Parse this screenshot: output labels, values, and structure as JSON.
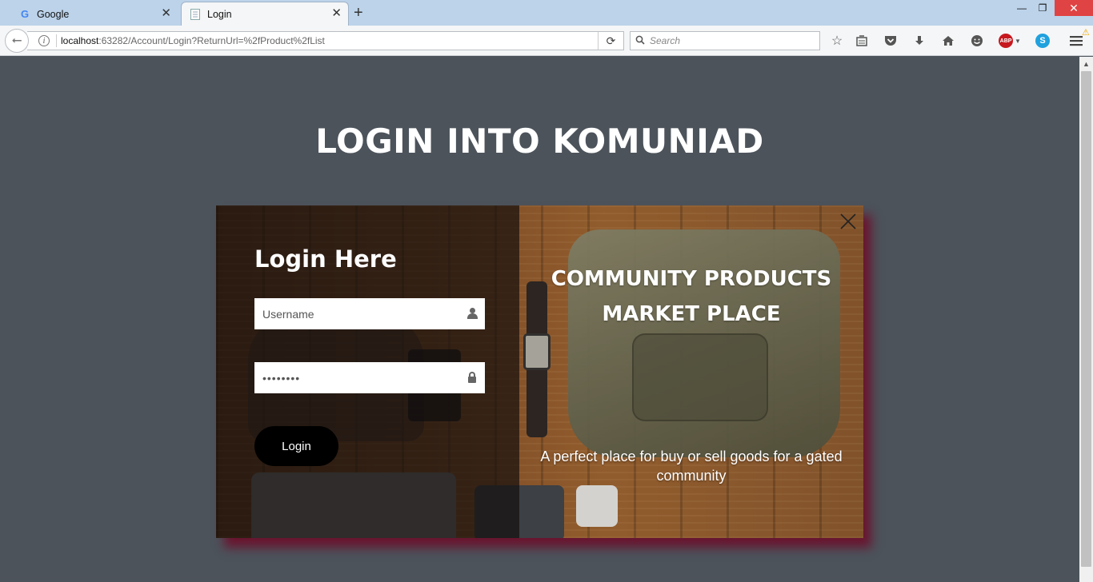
{
  "browser": {
    "tabs": [
      {
        "label": "Google",
        "favicon": "G"
      },
      {
        "label": "Login",
        "favicon": "page"
      }
    ],
    "url_host": "localhost",
    "url_path": ":63282/Account/Login?ReturnUrl=%2fProduct%2fList",
    "search_placeholder": "Search"
  },
  "page": {
    "title": "LOGIN INTO KOMUNIAD",
    "login_heading": "Login Here",
    "username_placeholder": "Username",
    "password_value": "••••••••",
    "login_button": "Login",
    "promo_title_line1": "COMMUNITY PRODUCTS",
    "promo_title_line2": "MARKET PLACE",
    "promo_text": "A perfect place for buy or sell goods for a gated community"
  },
  "colors": {
    "page_background": "#4c535b",
    "button_background": "#000000",
    "card_shadow": "#6e0a28",
    "close_button": "#e04343"
  }
}
